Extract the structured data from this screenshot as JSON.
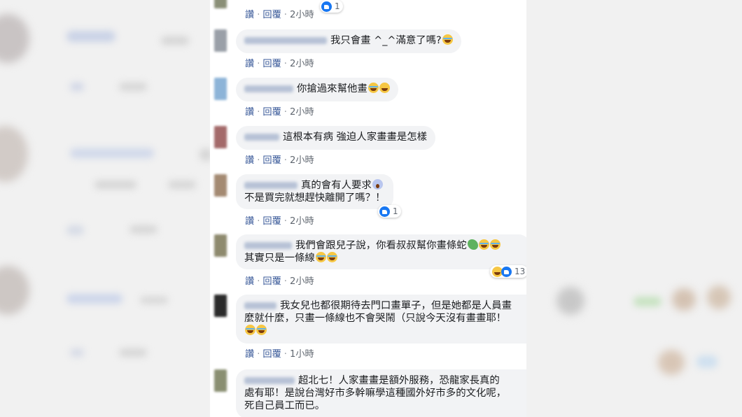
{
  "actions": {
    "like": "讚",
    "reply": "回覆",
    "separator": "·"
  },
  "comments": [
    {
      "text_lines": [],
      "time": "2小時",
      "reactions": {
        "count": "1"
      }
    },
    {
      "text_lines": [
        "我只會畫 ^_^滿意了嗎?"
      ],
      "emoji": [
        "laughing-crying"
      ],
      "time": "2小時"
    },
    {
      "text_lines": [
        "你搶過來幫他畫"
      ],
      "emoji": [
        "rolling-laughing",
        "grinning"
      ],
      "time": "2小時"
    },
    {
      "text_lines": [
        "這根本有病 強迫人家畫畫是怎樣"
      ],
      "time": "2小時"
    },
    {
      "text_lines": [
        "真的會有人要求",
        "不是買完就想趕快離開了嗎？！"
      ],
      "emoji": [
        "screaming"
      ],
      "time": "2小時",
      "reactions": {
        "count": "1"
      }
    },
    {
      "text_lines": [
        "我們會跟兒子說，你看叔叔幫你畫條蛇",
        "其實只是一條線"
      ],
      "emoji": [
        "snake",
        "laughing-crying",
        "laughing-crying"
      ],
      "time": "2小時",
      "reactions": {
        "count": "13"
      }
    },
    {
      "text_lines": [
        "我女兒也都很期待去門口畫單子，但是她都是人員畫",
        "麼就什麼，只畫一條線也不會哭鬧（只說今天沒有畫畫耶！"
      ],
      "emoji": [
        "rolling-laughing",
        "rolling-laughing"
      ],
      "time": "1小時"
    },
    {
      "text_lines": [
        "超北七！人家畫畫是額外服務，恐龍家長真的",
        "處有耶！是說台灣好市多幹嘛學這種國外好市多的文化呢，",
        "死自己員工而已。"
      ]
    }
  ],
  "colors": {
    "link": "#385898",
    "bubble": "#f2f3f5",
    "like": "#1877f2"
  }
}
